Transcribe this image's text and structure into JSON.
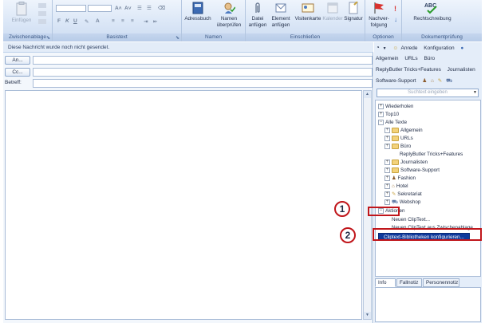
{
  "ribbon": {
    "groups": {
      "clipboard": "Zwischenablage",
      "basic_text": "Basistext",
      "names": "Namen",
      "include": "Einschließen",
      "options": "Optionen",
      "proofing": "Dokumentprüfung"
    },
    "buttons": {
      "paste": "Einfügen",
      "address_book": "Adressbuch",
      "check_names_1": "Namen",
      "check_names_2": "überprüfen",
      "attach_file_1": "Datei",
      "attach_file_2": "anfügen",
      "attach_item_1": "Element",
      "attach_item_2": "anfügen",
      "business_card": "Visitenkarte",
      "calendar": "Kalender",
      "signature": "Signatur",
      "follow_up_1": "Nachver-",
      "follow_up_2": "folgung",
      "spelling": "Rechtschreibung",
      "abc": "ABC"
    }
  },
  "compose": {
    "info_message": "Diese Nachricht wurde noch nicht gesendet.",
    "to_button": "An...",
    "cc_button": "Cc...",
    "subject_label": "Betreff:"
  },
  "pane": {
    "toolbar": {
      "salutation": "Anrede",
      "configuration": "Konfiguration"
    },
    "categories_row1": [
      "Allgemein",
      "URLs",
      "Büro"
    ],
    "categories_row2": [
      "ReplyButler Tricks+Features",
      "Journalisten"
    ],
    "categories_row3": [
      "Software-Support"
    ],
    "search_placeholder": "Suchtext eingeben",
    "tree": {
      "repeat": "Wiederholen",
      "top10": "Top10",
      "all_texts": "Alle Texte",
      "general": "Allgemein",
      "urls": "URLs",
      "office": "Büro",
      "replybutler": "ReplyButler Tricks+Features",
      "journalists": "Journalisten",
      "software_support": "Software-Support",
      "fashion": "Fashion",
      "hotel": "Hotel",
      "secretary": "Sekretariat",
      "webshop": "Webshop",
      "actions": "Aktionen",
      "new_cliptext": "Neuen ClipText...",
      "new_cliptext_clipboard": "Neuen ClipText aus Zwischenablage",
      "configure_libraries": "Cliptext-Bibliotheken konfigurieren..."
    },
    "tabs": [
      "Info",
      "Fallnotiz",
      "Personennotiz"
    ]
  },
  "annotations": {
    "callout_1": "1",
    "callout_2": "2"
  },
  "colors": {
    "ribbon_bg": "#dbe7f7",
    "selected_item": "#0f3a9c",
    "annotation_red": "#c0161b"
  }
}
